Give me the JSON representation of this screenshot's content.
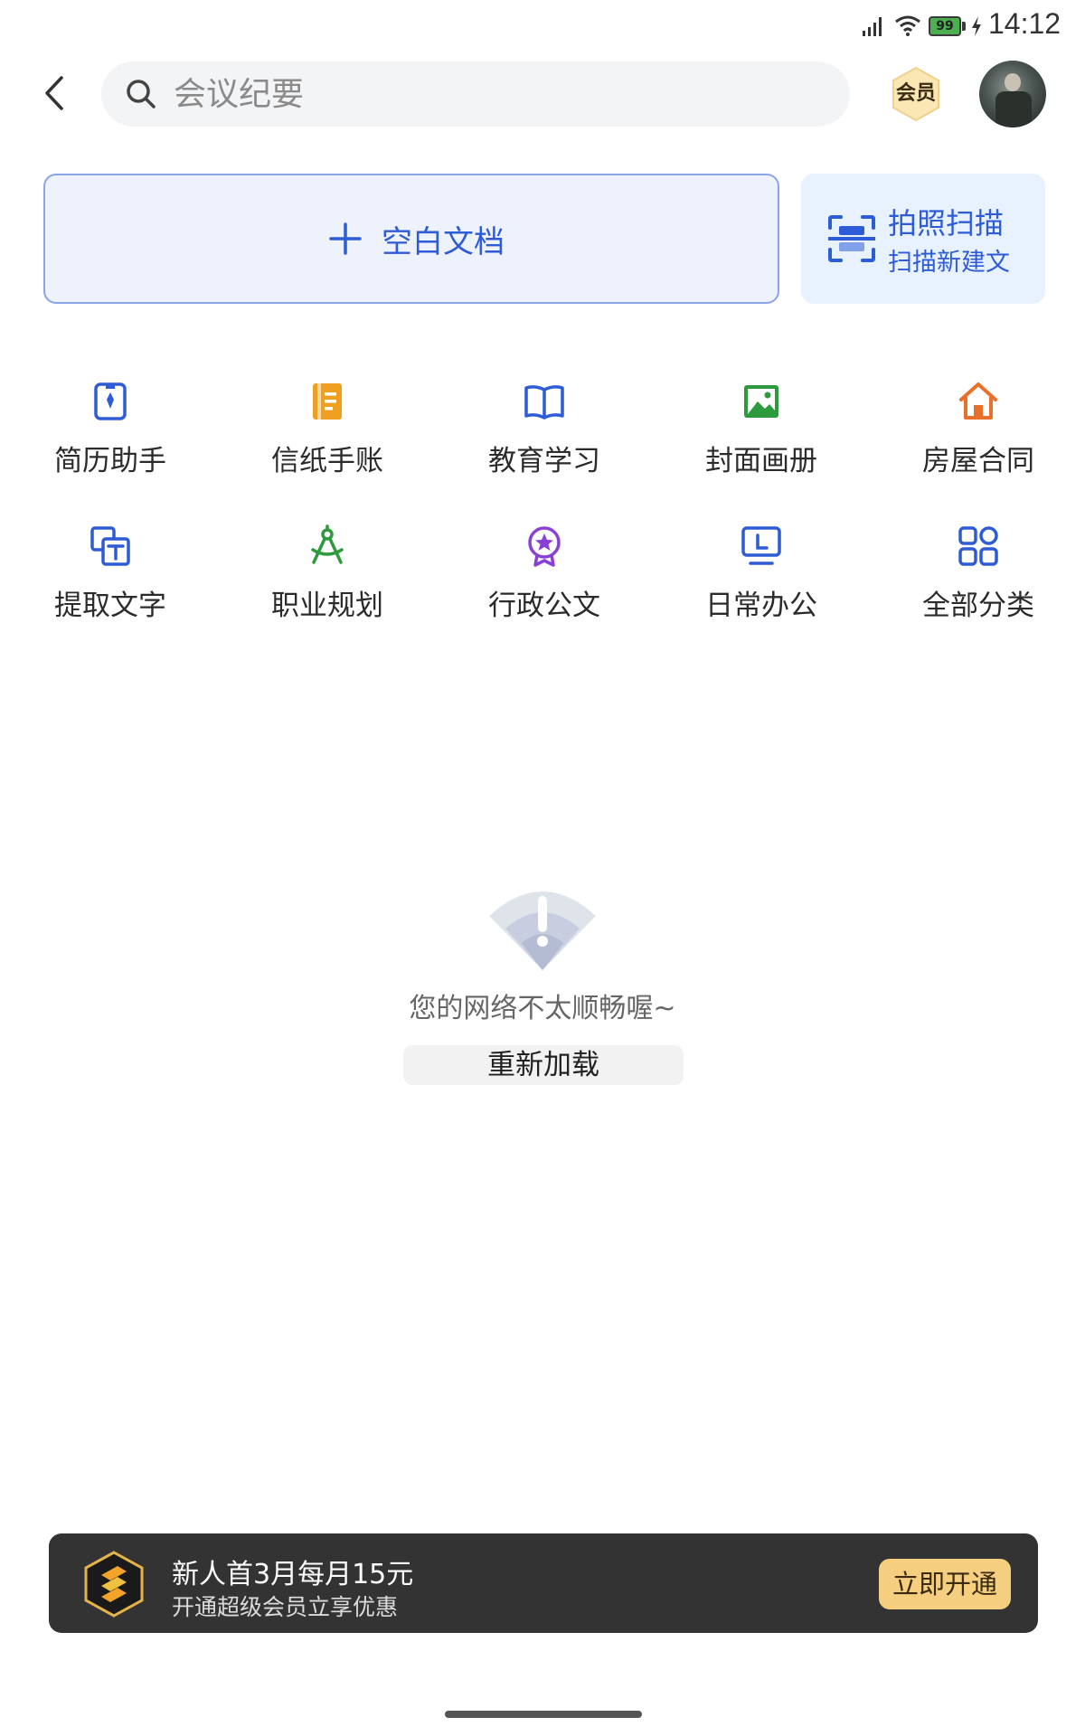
{
  "status_bar": {
    "battery": "99",
    "time": "14:12"
  },
  "header": {
    "search_placeholder": "会议纪要",
    "vip_label": "会员"
  },
  "actions": {
    "blank_doc": "空白文档",
    "scan_title": "拍照扫描",
    "scan_subtitle": "扫描新建文"
  },
  "categories": [
    {
      "label": "简历助手",
      "icon": "resume-icon",
      "color": "#2e5cd6"
    },
    {
      "label": "信纸手账",
      "icon": "notebook-icon",
      "color": "#f0a020"
    },
    {
      "label": "教育学习",
      "icon": "book-icon",
      "color": "#2e5cd6"
    },
    {
      "label": "封面画册",
      "icon": "image-icon",
      "color": "#2e9a3e"
    },
    {
      "label": "房屋合同",
      "icon": "house-icon",
      "color": "#e8702a"
    },
    {
      "label": "提取文字",
      "icon": "extract-text-icon",
      "color": "#2e5cd6"
    },
    {
      "label": "职业规划",
      "icon": "compass-icon",
      "color": "#2e9a3e"
    },
    {
      "label": "行政公文",
      "icon": "badge-star-icon",
      "color": "#8a3fd6"
    },
    {
      "label": "日常办公",
      "icon": "monitor-icon",
      "color": "#2e5cd6"
    },
    {
      "label": "全部分类",
      "icon": "grid-icon",
      "color": "#2e5cd6"
    }
  ],
  "network_error": {
    "message": "您的网络不太顺畅喔~",
    "reload_label": "重新加载"
  },
  "promo": {
    "title": "新人首3月每月15元",
    "subtitle": "开通超级会员立享优惠",
    "cta": "立即开通"
  }
}
